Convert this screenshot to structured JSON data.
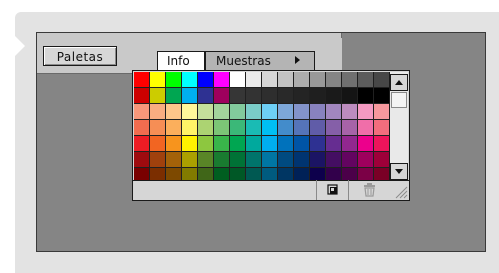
{
  "panel_button": {
    "label": "Paletas"
  },
  "tabs": [
    {
      "label": "Info",
      "active": true
    },
    {
      "label": "Muestras",
      "active": false
    }
  ],
  "icons": {
    "tab_menu": "triangle-right-icon",
    "scroll_up": "arrow-up-icon",
    "scroll_down": "arrow-down-icon",
    "new_swatch": "new-swatch-icon",
    "delete_swatch": "trash-icon",
    "resize": "resize-grip-icon"
  },
  "colors": {
    "background": "#e3e3e3",
    "panel_gray": "#858585",
    "window_chrome": "#d6d6d6"
  },
  "swatch_rows": [
    [
      "#ff0000",
      "#ffff00",
      "#00ff00",
      "#00ffff",
      "#0000ff",
      "#ff00ff",
      "#ffffff",
      "#ebebeb",
      "#d6d6d6",
      "#c2c2c2",
      "#adadad",
      "#999999",
      "#858585",
      "#707070",
      "#5c5c5c",
      "#474747"
    ],
    [
      "#cc0000",
      "#cccc00",
      "#00a651",
      "#00aeef",
      "#2e3192",
      "#9e005d",
      "#363636",
      "#333333",
      "#2e2e2e",
      "#292929",
      "#242424",
      "#1f1f1f",
      "#1a1a1a",
      "#141414",
      "#000000",
      "#000000"
    ],
    [
      "#f7977a",
      "#f9ad81",
      "#fdc68a",
      "#fff79a",
      "#c4df9b",
      "#a3d39c",
      "#82ca9c",
      "#7accc8",
      "#6dcff6",
      "#7da7d9",
      "#8393ca",
      "#8882be",
      "#a186be",
      "#bd8cbf",
      "#f49ac2",
      "#f6989d"
    ],
    [
      "#f26c4f",
      "#f68e55",
      "#fbaf5c",
      "#fff467",
      "#acd372",
      "#7cc576",
      "#3bb878",
      "#1abbb4",
      "#00bff3",
      "#438ccb",
      "#5574b9",
      "#605ca8",
      "#855fa8",
      "#a763a8",
      "#f06ea9",
      "#f26d7d"
    ],
    [
      "#ed1c24",
      "#f26522",
      "#f7941d",
      "#fff200",
      "#8dc73f",
      "#39b54a",
      "#00a651",
      "#00a99d",
      "#00aeef",
      "#0072bc",
      "#0054a6",
      "#2e3192",
      "#662d91",
      "#92278f",
      "#ec008c",
      "#ed145b"
    ],
    [
      "#9e0b0f",
      "#a0410d",
      "#a36209",
      "#aba000",
      "#598527",
      "#197b30",
      "#007236",
      "#00746b",
      "#0076a3",
      "#004a80",
      "#003471",
      "#1b1464",
      "#440e62",
      "#630460",
      "#9e005d",
      "#9e0039"
    ],
    [
      "#790000",
      "#7b2e00",
      "#7d4900",
      "#827b00",
      "#406618",
      "#005e20",
      "#005826",
      "#005952",
      "#005b7f",
      "#003663",
      "#002157",
      "#0d004c",
      "#32004b",
      "#4b0049",
      "#7b0046",
      "#7a0026"
    ]
  ]
}
